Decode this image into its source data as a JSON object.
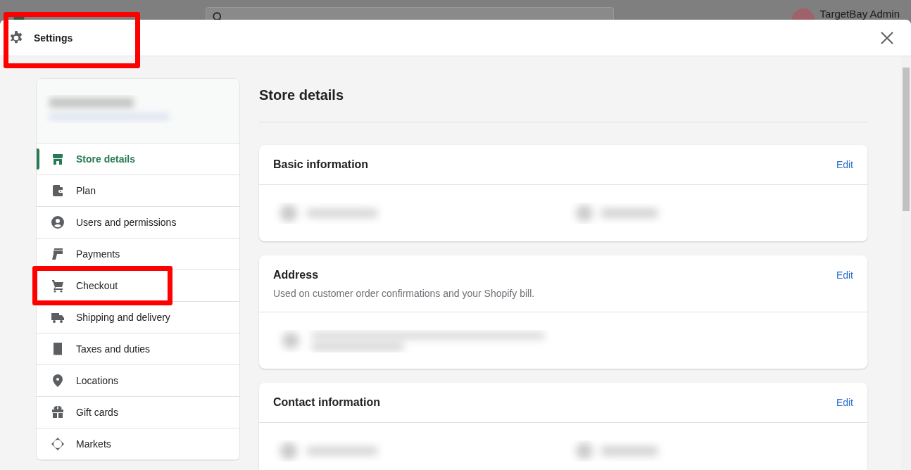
{
  "backdrop": {
    "user": {
      "name": "TargetBay Admin"
    }
  },
  "modal": {
    "title": "Settings",
    "highlighted": true
  },
  "sidebar": {
    "items": [
      {
        "label": "Store details",
        "selected": true,
        "highlighted": false
      },
      {
        "label": "Plan",
        "selected": false,
        "highlighted": false
      },
      {
        "label": "Users and permissions",
        "selected": false,
        "highlighted": false
      },
      {
        "label": "Payments",
        "selected": false,
        "highlighted": false
      },
      {
        "label": "Checkout",
        "selected": false,
        "highlighted": true
      },
      {
        "label": "Shipping and delivery",
        "selected": false,
        "highlighted": false
      },
      {
        "label": "Taxes and duties",
        "selected": false,
        "highlighted": false
      },
      {
        "label": "Locations",
        "selected": false,
        "highlighted": false
      },
      {
        "label": "Gift cards",
        "selected": false,
        "highlighted": false
      },
      {
        "label": "Markets",
        "selected": false,
        "highlighted": false
      }
    ]
  },
  "page": {
    "title": "Store details",
    "cards": [
      {
        "title": "Basic information",
        "action": "Edit"
      },
      {
        "title": "Address",
        "action": "Edit",
        "description": "Used on customer order confirmations and your Shopify bill."
      },
      {
        "title": "Contact information",
        "action": "Edit"
      }
    ]
  }
}
